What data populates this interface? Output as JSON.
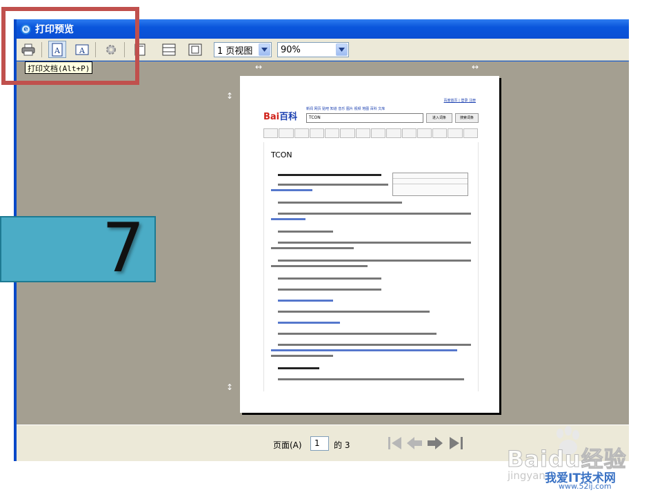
{
  "window": {
    "title": "打印预览"
  },
  "toolbar": {
    "tooltip": "打印文档(Alt+P)",
    "view_select": "1 页视图",
    "zoom_select": "90%"
  },
  "document": {
    "top_links": "百度首页 | 登录 注册",
    "nav_links": "新闻 网页 贴吧 知道 音乐 图片 视频 地图 百科 文库",
    "logo_bai": "Bai",
    "logo_du": "百科",
    "search_value": "TCON",
    "enter_button": "进入词条",
    "search_button": "搜索词条",
    "article_title": "TCON"
  },
  "nav": {
    "page_label": "页面(A)",
    "page_value": "1",
    "of_label": "的 3"
  },
  "overlay": {
    "slide_number": "7"
  },
  "watermark": {
    "brand": "Baidu经验",
    "sub": "jingyan",
    "site": "我爱IT技术网",
    "url": "www.52ij.com"
  },
  "colors": {
    "titlebar": "#0a56dc",
    "preview_bg": "#a49f91",
    "highlight": "#c0504d",
    "badge": "#4bacc6"
  }
}
